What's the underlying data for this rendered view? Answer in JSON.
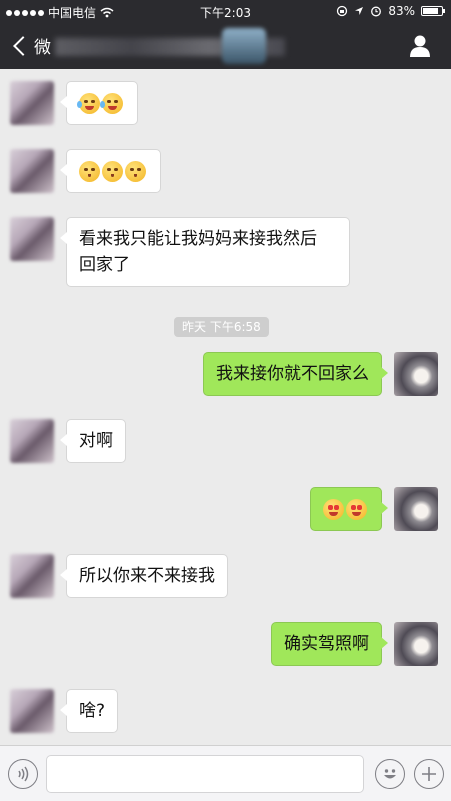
{
  "status_bar": {
    "carrier": "中国电信",
    "time": "下午2:03",
    "battery": "83%",
    "battery_fraction": 0.83
  },
  "navbar": {
    "back_label": "微",
    "title": ""
  },
  "chat": {
    "timestamp": "昨天 下午6:58",
    "messages": [
      {
        "from": "her",
        "text": "",
        "emoji": [
          "tears-of-joy",
          "tears-of-joy"
        ]
      },
      {
        "from": "her",
        "text": "",
        "emoji": [
          "kissing-face",
          "kissing-face",
          "kissing-face"
        ]
      },
      {
        "from": "her",
        "text": "看来我只能让我妈妈来接我然后\n回家了"
      },
      {
        "from": "me",
        "text": "我来接你就不回家么"
      },
      {
        "from": "her",
        "text": "对啊"
      },
      {
        "from": "me",
        "text": "",
        "emoji": [
          "heart-eyes",
          "heart-eyes"
        ]
      },
      {
        "from": "her",
        "text": "所以你来不来接我"
      },
      {
        "from": "me",
        "text": "确实驾照啊"
      },
      {
        "from": "her",
        "text": "啥?"
      }
    ]
  },
  "input_bar": {
    "placeholder": "",
    "voice_icon": "voice-icon",
    "emoji_icon": "emoji-icon",
    "add_icon": "plus-icon"
  },
  "colors": {
    "header": "#2b2b2f",
    "chat_bg": "#ebebeb",
    "my_bubble": "#a0e75a",
    "their_bubble": "#ffffff"
  }
}
